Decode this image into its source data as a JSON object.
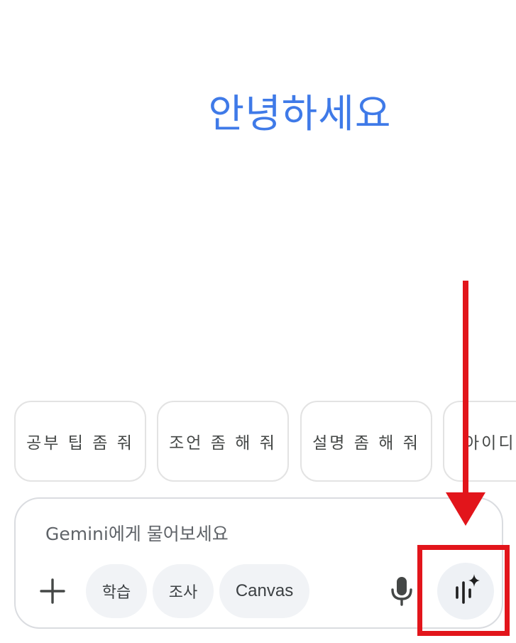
{
  "greeting": "안녕하세요",
  "suggestions": [
    {
      "label": "공부 팁 좀 줘"
    },
    {
      "label": "조언 좀 해 줘"
    },
    {
      "label": "설명 좀 해 줘"
    },
    {
      "label": "아이디어"
    }
  ],
  "composer": {
    "placeholder": "Gemini에게 물어보세요",
    "tools": [
      {
        "label": "학습"
      },
      {
        "label": "조사"
      },
      {
        "label": "Canvas"
      }
    ],
    "icons": {
      "add": "plus-icon",
      "mic": "microphone-icon",
      "live": "gemini-live-icon"
    }
  },
  "annotation": {
    "color": "#e2151b"
  },
  "colors": {
    "greeting": "#3f7ae8",
    "chip_border": "#e3e3e3",
    "pill_bg": "#f1f3f6"
  }
}
